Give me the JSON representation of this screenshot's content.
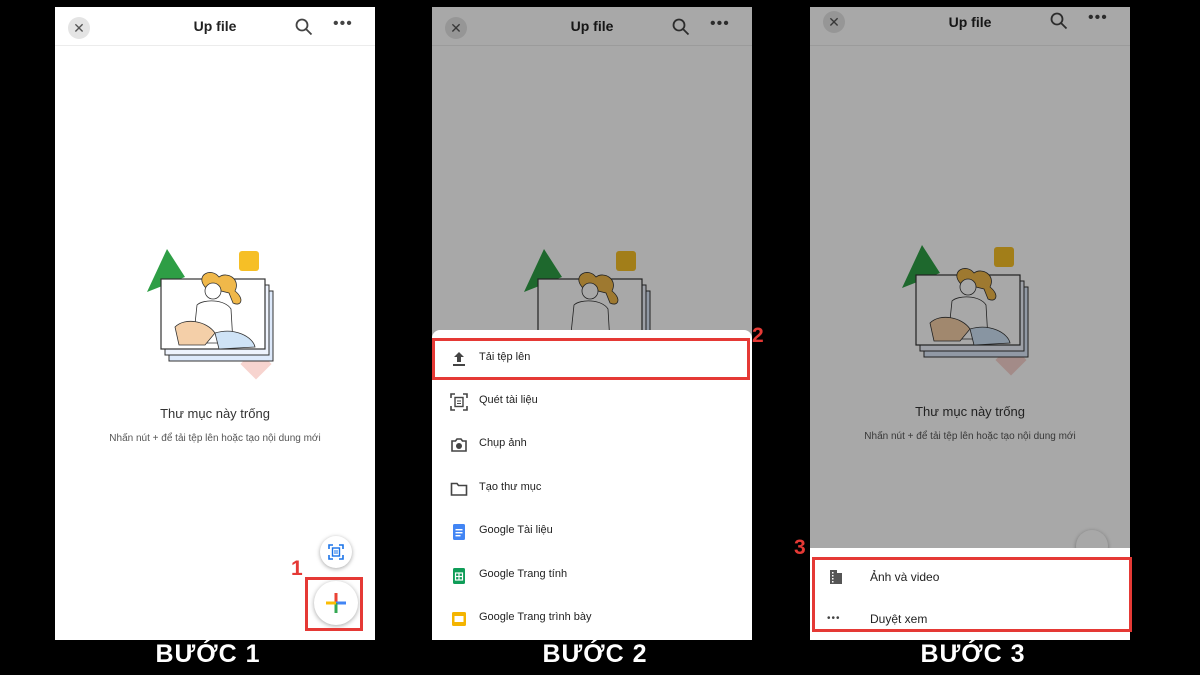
{
  "header": {
    "title": "Up file"
  },
  "empty_state": {
    "title": "Thư mục này trống",
    "subtitle": "Nhấn nút + để tải tệp lên hoặc tạo nội dung mới"
  },
  "create_menu": {
    "items": [
      {
        "label": "Tải tệp lên",
        "icon": "upload-icon"
      },
      {
        "label": "Quét tài liệu",
        "icon": "scan-icon"
      },
      {
        "label": "Chụp ảnh",
        "icon": "camera-icon"
      },
      {
        "label": "Tạo thư mục",
        "icon": "folder-icon"
      },
      {
        "label": "Google Tài liệu",
        "icon": "google-docs-icon"
      },
      {
        "label": "Google Trang tính",
        "icon": "google-sheets-icon"
      },
      {
        "label": "Google Trang trình bày",
        "icon": "google-slides-icon"
      }
    ]
  },
  "upload_menu": {
    "items": [
      {
        "label": "Ảnh và video",
        "icon": "photos-icon"
      },
      {
        "label": "Duyệt xem",
        "icon": "more-icon"
      }
    ]
  },
  "steps": {
    "s1": "BƯỚC 1",
    "s2": "BƯỚC 2",
    "s3": "BƯỚC 3"
  },
  "markers": {
    "m1": "1",
    "m2": "2",
    "m3": "3"
  },
  "colors": {
    "highlight": "#e53935",
    "docs": "#4285f4",
    "sheets": "#0f9d58",
    "slides": "#f4b400"
  }
}
